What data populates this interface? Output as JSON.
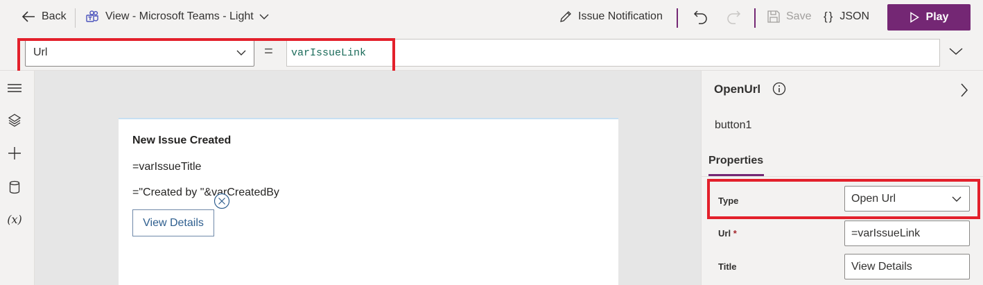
{
  "toolbar": {
    "back_label": "Back",
    "view_label": "View - Microsoft Teams - Light",
    "issue_notification_label": "Issue Notification",
    "save_label": "Save",
    "json_label": "JSON",
    "play_label": "Play",
    "accent_color": "#742774"
  },
  "formula_bar": {
    "property": "Url",
    "equals": "=",
    "formula": "varIssueLink"
  },
  "card": {
    "title": "New Issue Created",
    "line1": "=varIssueTitle",
    "line2": "=\"Created by \"&varCreatedBy",
    "button_label": "View Details"
  },
  "right_panel": {
    "action_title": "OpenUrl",
    "element_name": "button1",
    "tab_label": "Properties",
    "fields": {
      "type": {
        "label": "Type",
        "value": "Open Url"
      },
      "url": {
        "label": "Url",
        "required_mark": "*",
        "value": "=varIssueLink"
      },
      "title": {
        "label": "Title",
        "value": "View Details"
      }
    }
  },
  "highlight_color": "#e3202b"
}
